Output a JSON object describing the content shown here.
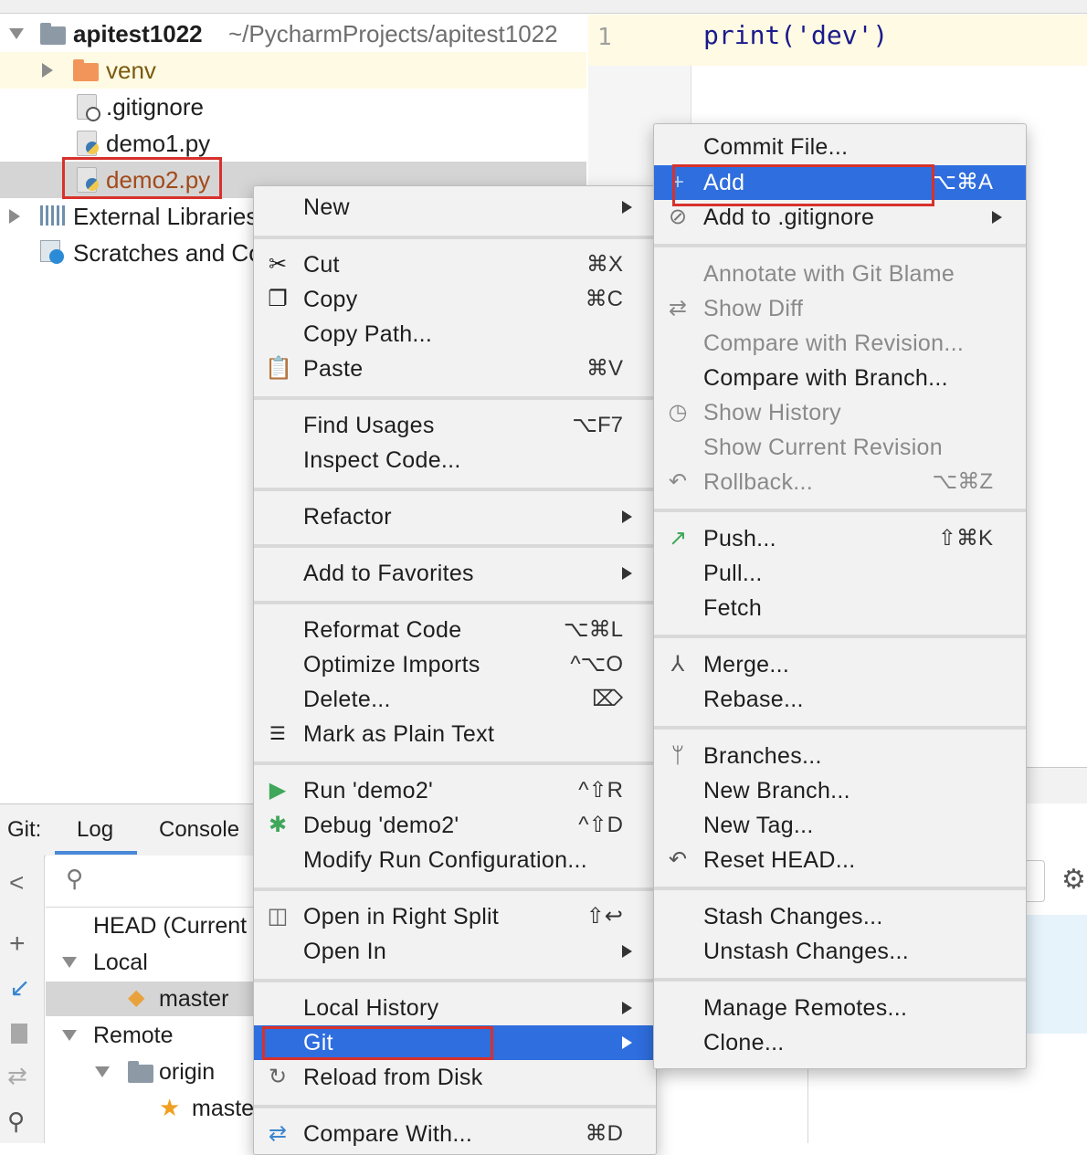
{
  "project_tree": {
    "root_name": "apitest1022",
    "root_path": "~/PycharmProjects/apitest1022",
    "items": [
      {
        "label": "venv"
      },
      {
        "label": ".gitignore"
      },
      {
        "label": "demo1.py"
      },
      {
        "label": "demo2.py"
      },
      {
        "label": "External Libraries"
      },
      {
        "label": "Scratches and Consoles"
      }
    ]
  },
  "editor": {
    "line_number": "1",
    "code": "print('dev')"
  },
  "git_panel": {
    "title": "Git:",
    "tabs": [
      {
        "label": "Log"
      },
      {
        "label": "Console"
      }
    ],
    "search_placeholder": "",
    "branches": {
      "head": "HEAD (Current Branch)",
      "local": "Local",
      "local_master": "master",
      "remote": "Remote",
      "origin": "origin",
      "origin_master": "master"
    }
  },
  "context_menu": {
    "items": [
      {
        "label": "New"
      },
      {
        "label": "Cut",
        "shortcut": "⌘X"
      },
      {
        "label": "Copy",
        "shortcut": "⌘C"
      },
      {
        "label": "Copy Path..."
      },
      {
        "label": "Paste",
        "shortcut": "⌘V"
      },
      {
        "label": "Find Usages",
        "shortcut": "⌥F7"
      },
      {
        "label": "Inspect Code..."
      },
      {
        "label": "Refactor"
      },
      {
        "label": "Add to Favorites"
      },
      {
        "label": "Reformat Code",
        "shortcut": "⌥⌘L"
      },
      {
        "label": "Optimize Imports",
        "shortcut": "^⌥O"
      },
      {
        "label": "Delete...",
        "shortcut": "⌦"
      },
      {
        "label": "Mark as Plain Text"
      },
      {
        "label": "Run 'demo2'",
        "shortcut": "^⇧R"
      },
      {
        "label": "Debug 'demo2'",
        "shortcut": "^⇧D"
      },
      {
        "label": "Modify Run Configuration..."
      },
      {
        "label": "Open in Right Split",
        "shortcut": "⇧↩"
      },
      {
        "label": "Open In"
      },
      {
        "label": "Local History"
      },
      {
        "label": "Git"
      },
      {
        "label": "Reload from Disk"
      },
      {
        "label": "Compare With...",
        "shortcut": "⌘D"
      }
    ]
  },
  "git_submenu": {
    "items": [
      {
        "label": "Commit File..."
      },
      {
        "label": "Add",
        "shortcut": "⌥⌘A"
      },
      {
        "label": "Add to .gitignore"
      },
      {
        "label": "Annotate with Git Blame"
      },
      {
        "label": "Show Diff"
      },
      {
        "label": "Compare with Revision..."
      },
      {
        "label": "Compare with Branch..."
      },
      {
        "label": "Show History"
      },
      {
        "label": "Show Current Revision"
      },
      {
        "label": "Rollback...",
        "shortcut": "⌥⌘Z"
      },
      {
        "label": "Push...",
        "shortcut": "⇧⌘K"
      },
      {
        "label": "Pull..."
      },
      {
        "label": "Fetch"
      },
      {
        "label": "Merge..."
      },
      {
        "label": "Rebase..."
      },
      {
        "label": "Branches..."
      },
      {
        "label": "New Branch..."
      },
      {
        "label": "New Tag..."
      },
      {
        "label": "Reset HEAD..."
      },
      {
        "label": "Stash Changes..."
      },
      {
        "label": "Unstash Changes..."
      },
      {
        "label": "Manage Remotes..."
      },
      {
        "label": "Clone..."
      }
    ]
  },
  "colors": {
    "selection": "#2f6ede",
    "highlight_box": "#d8312b",
    "venv_row": "#fffae3",
    "modified_file": "#a24a1a"
  }
}
